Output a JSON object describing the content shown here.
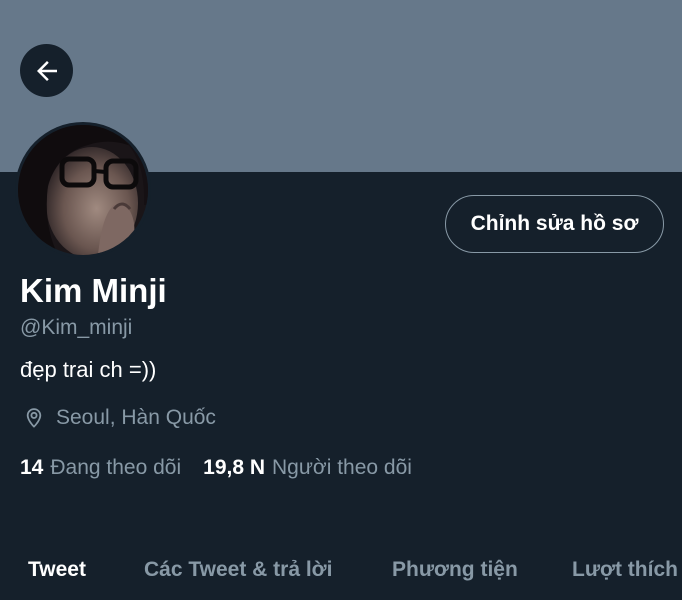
{
  "profile": {
    "edit_button_label": "Chỉnh sửa hồ sơ",
    "display_name": "Kim Minji",
    "handle": "@Kim_minji",
    "bio": "đẹp trai ch =))",
    "location": "Seoul, Hàn Quốc",
    "following_count": "14",
    "following_label": "Đang theo dõi",
    "followers_count": "19,8 N",
    "followers_label": "Người theo dõi"
  },
  "tabs": [
    {
      "label": "Tweet",
      "active": true
    },
    {
      "label": "Các Tweet & trả lời",
      "active": false
    },
    {
      "label": "Phương tiện",
      "active": false
    },
    {
      "label": "Lượt thích",
      "active": false
    }
  ],
  "icons": {
    "back": "arrow-left-icon",
    "location": "location-pin-icon"
  },
  "colors": {
    "background": "#15202b",
    "banner": "#66788a",
    "secondary_text": "#8899a6",
    "primary_text": "#ffffff"
  }
}
